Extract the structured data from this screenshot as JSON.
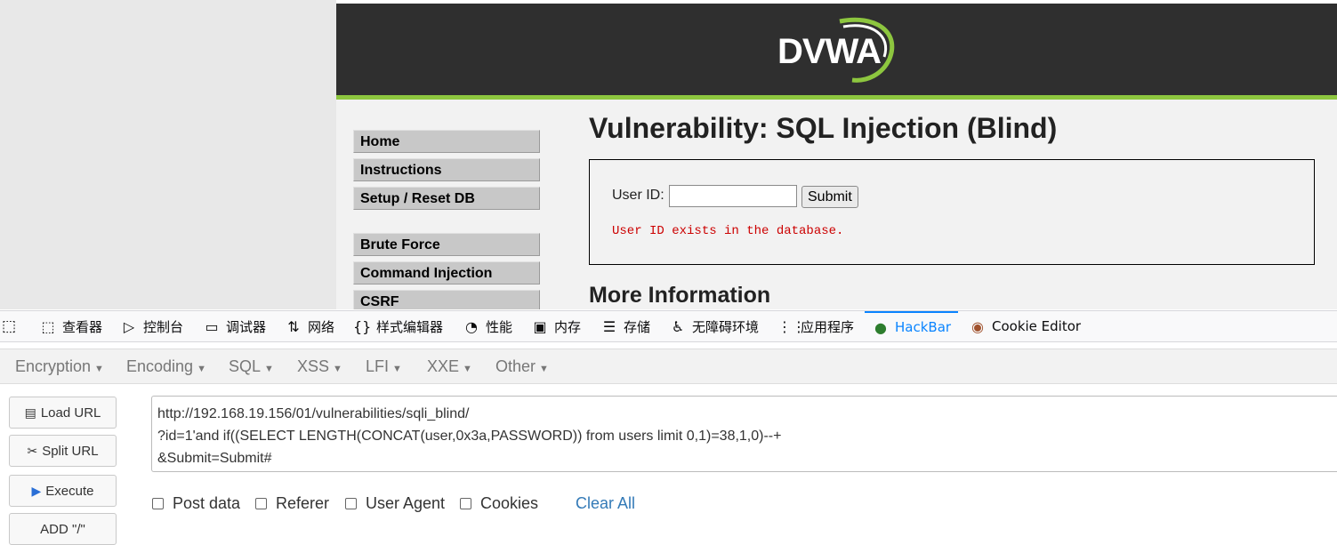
{
  "dvwa": {
    "logo_text": "DVWA",
    "menu": [
      "Home",
      "Instructions",
      "Setup / Reset DB",
      "Brute Force",
      "Command Injection",
      "CSRF"
    ],
    "title": "Vulnerability: SQL Injection (Blind)",
    "user_id_label": "User ID:",
    "user_id_value": "",
    "submit_label": "Submit",
    "result_message": "User ID exists in the database.",
    "more_info": "More Information",
    "colors": {
      "header": "#2f2f2f",
      "accent": "#8dc63f",
      "error": "#cc0000"
    }
  },
  "devtools": {
    "tabs": [
      {
        "icon": "inspector-icon",
        "label": "查看器"
      },
      {
        "icon": "console-icon",
        "label": "控制台"
      },
      {
        "icon": "debugger-icon",
        "label": "调试器"
      },
      {
        "icon": "network-icon",
        "label": "网络"
      },
      {
        "icon": "style-editor-icon",
        "label": "样式编辑器"
      },
      {
        "icon": "performance-icon",
        "label": "性能"
      },
      {
        "icon": "memory-icon",
        "label": "内存"
      },
      {
        "icon": "storage-icon",
        "label": "存储"
      },
      {
        "icon": "accessibility-icon",
        "label": "无障碍环境"
      },
      {
        "icon": "application-icon",
        "label": "应用程序"
      },
      {
        "icon": "hackbar-icon",
        "label": "HackBar"
      },
      {
        "icon": "cookie-icon",
        "label": "Cookie Editor"
      }
    ],
    "active_tab": "HackBar"
  },
  "hackbar": {
    "menu": [
      "Encryption",
      "Encoding",
      "SQL",
      "XSS",
      "LFI",
      "XXE",
      "Other"
    ],
    "buttons": {
      "load_url": "Load URL",
      "split_url": "Split URL",
      "execute": "Execute",
      "add_slashes": "ADD \"/\""
    },
    "url_lines": [
      "http://192.168.19.156/01/vulnerabilities/sqli_blind/",
      "?id=1'and if((SELECT LENGTH(CONCAT(user,0x3a,PASSWORD)) from users limit 0,1)=38,1,0)--+",
      "&Submit=Submit#"
    ],
    "options": [
      {
        "label": "Post data",
        "checked": false
      },
      {
        "label": "Referer",
        "checked": false
      },
      {
        "label": "User Agent",
        "checked": false
      },
      {
        "label": "Cookies",
        "checked": false
      }
    ],
    "clear_all": "Clear All"
  }
}
